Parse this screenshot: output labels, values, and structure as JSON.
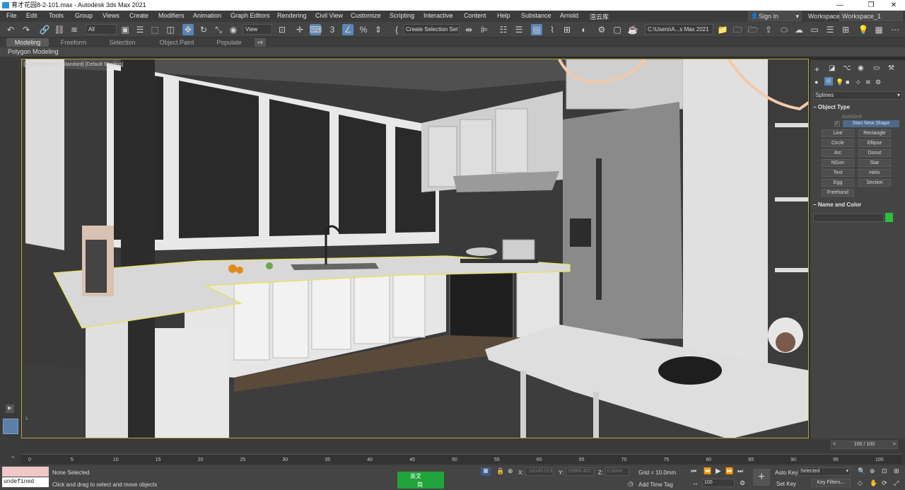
{
  "titlebar": {
    "title": "育才花园8-2-101.max - Autodesk 3ds Max 2021",
    "min": "—",
    "max": "❐",
    "close": "✕"
  },
  "menu": [
    "File",
    "Edit",
    "Tools",
    "Group",
    "Views",
    "Create",
    "Modifiers",
    "Animation",
    "Graph Editors",
    "Rendering",
    "Civil View",
    "Customize",
    "Scripting",
    "Interactive",
    "Content",
    "Help",
    "Substance",
    "Arnold",
    "渲云库"
  ],
  "signin": "Sign In",
  "workspaces": {
    "label": "Workspaces:",
    "value": "Workspace_1"
  },
  "toolbar": {
    "selection_filter": "All",
    "ref_coord": "View",
    "named_selection": "Create Selection Set",
    "path": "C:\\Users\\A...s Max 2021"
  },
  "ribbon": {
    "tabs": [
      "Modeling",
      "Freeform",
      "Selection",
      "Object Paint",
      "Populate"
    ],
    "sub": "Polygon Modeling"
  },
  "viewport": {
    "label": "[+] [Perspective] [Standard] [Default Shading]"
  },
  "command_panel": {
    "category": "Splines",
    "object_type_header": "Object Type",
    "autogrid": "AutoGrid",
    "start_new_shape": "Start New Shape",
    "buttons": [
      "Line",
      "Rectangle",
      "Circle",
      "Ellipse",
      "Arc",
      "Donut",
      "NGon",
      "Star",
      "Text",
      "Helix",
      "Egg",
      "Section",
      "Freehand"
    ],
    "name_color_header": "Name and Color",
    "color": "#2ebd3e"
  },
  "timeline": {
    "frame_display": "100 / 100",
    "ticks": [
      "0",
      "5",
      "10",
      "15",
      "20",
      "25",
      "30",
      "35",
      "40",
      "45",
      "50",
      "55",
      "60",
      "65",
      "70",
      "75",
      "80",
      "85",
      "90",
      "95",
      "100"
    ]
  },
  "status": {
    "maxscript": "undefined",
    "selected": "None Selected",
    "prompt": "Click and drag to select and move objects",
    "ime1": "英文",
    "ime2": "简",
    "x_label": "X:",
    "x_value": "-18149.019",
    "y_label": "Y:",
    "y_value": "16966.462",
    "z_label": "Z:",
    "z_value": "0.0mm",
    "grid": "Grid = 10.0mm",
    "add_time_tag": "Add Time Tag",
    "auto_key": "Auto Key",
    "set_key": "Set Key",
    "selected_dropdown": "Selected",
    "key_filters": "Key Filters...",
    "frame": "100"
  }
}
